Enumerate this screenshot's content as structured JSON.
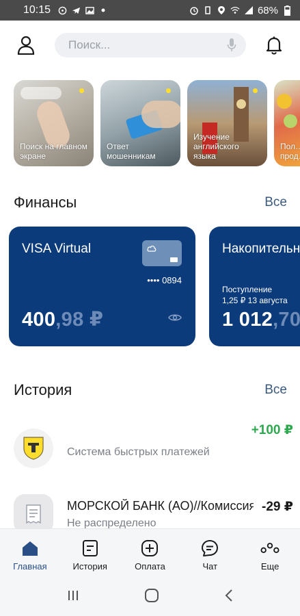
{
  "status_bar": {
    "time": "10:15",
    "battery": "68%"
  },
  "search": {
    "placeholder": "Поиск..."
  },
  "stories": [
    {
      "caption": "Поиск на главном экране"
    },
    {
      "caption": "Ответ мошенникам"
    },
    {
      "caption": "Изучение английского языка"
    },
    {
      "caption": "Пол… прод…"
    }
  ],
  "finance": {
    "title": "Финансы",
    "all_link": "Все",
    "cards": [
      {
        "title": "VISA Virtual",
        "card_number": "•••• 0894",
        "balance_int": "400",
        "balance_frac": ",98 ₽"
      },
      {
        "title": "Накопительн",
        "sub_line1": "Поступление",
        "sub_line2": "1,25 ₽  13 августа",
        "balance_int": "1 012",
        "balance_frac": ",70"
      }
    ]
  },
  "history": {
    "title": "История",
    "all_link": "Все",
    "items": [
      {
        "title": "",
        "subtitle": "Система быстрых платежей",
        "amount": "+100 ₽",
        "positive": true
      },
      {
        "title": "МОРСКОЙ БАНК (АО)//Комиссия",
        "subtitle": "Не распределено",
        "amount": "-29 ₽",
        "positive": false
      }
    ]
  },
  "bottom_nav": [
    {
      "label": "Главная",
      "icon": "home-icon",
      "active": true
    },
    {
      "label": "История",
      "icon": "history-icon",
      "active": false
    },
    {
      "label": "Оплата",
      "icon": "payment-icon",
      "active": false
    },
    {
      "label": "Чат",
      "icon": "chat-icon",
      "active": false
    },
    {
      "label": "Еще",
      "icon": "more-icon",
      "active": false
    }
  ],
  "colors": {
    "brand_blue": "#0c3b7c",
    "accent_yellow": "#ffdd2d",
    "positive_green": "#2ea84f",
    "link_blue": "#3b5a80"
  }
}
